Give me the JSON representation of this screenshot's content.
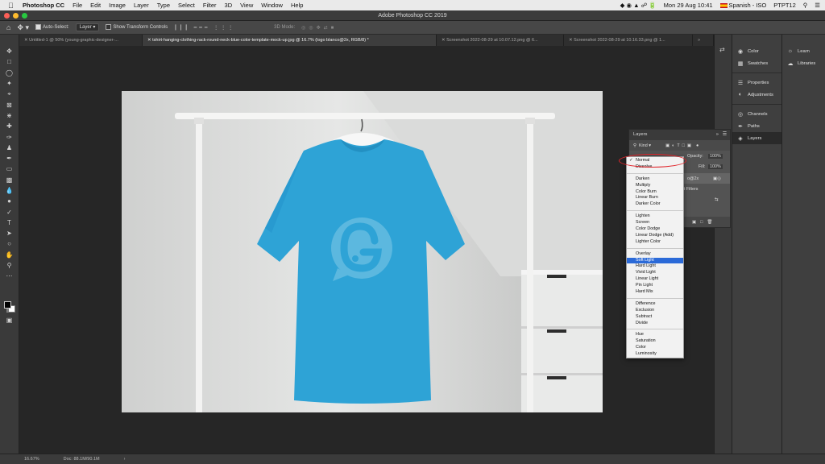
{
  "menubar": {
    "app_name": "Photoshop CC",
    "menus": [
      "File",
      "Edit",
      "Image",
      "Layer",
      "Type",
      "Select",
      "Filter",
      "3D",
      "View",
      "Window",
      "Help"
    ],
    "datetime": "Mon 29 Aug  10:41",
    "input_source": "Spanish - ISO",
    "user": "PTPT12"
  },
  "titlebar": {
    "title": "Adobe Photoshop CC 2019"
  },
  "options": {
    "auto_select_label": "Auto-Select:",
    "auto_select_value": "Layer",
    "transform_label": "Show Transform Controls",
    "mode_3d": "3D Mode:"
  },
  "tabs": [
    "Untitled-1 @ 50% (young-graphic-designer-...",
    "tshirt-hanging-clothing-rack-round-neck-blue-color-template-mock-up.jpg @ 16.7% (logo blanco@2x, RGB/8) *",
    "Screenshot 2022-08-29 at 10.07.12.png @ 6...",
    "Screenshot 2022-08-29 at 10.16.33.png @ 1..."
  ],
  "status": {
    "zoom": "16.67%",
    "doc": "Doc: 88.1M/90.1M"
  },
  "dock1": [
    {
      "icon": "color-icon",
      "label": "Color"
    },
    {
      "icon": "swatches-icon",
      "label": "Swatches"
    },
    {
      "icon": "properties-icon",
      "label": "Properties"
    },
    {
      "icon": "adjustments-icon",
      "label": "Adjustments"
    },
    {
      "icon": "channels-icon",
      "label": "Channels"
    },
    {
      "icon": "paths-icon",
      "label": "Paths"
    },
    {
      "icon": "layers-icon",
      "label": "Layers"
    }
  ],
  "dock2": [
    {
      "icon": "learn-icon",
      "label": "Learn"
    },
    {
      "icon": "libraries-icon",
      "label": "Libraries"
    }
  ],
  "layers_panel": {
    "title": "Layers",
    "kind_label": "Kind",
    "opacity_label": "Opacity:",
    "opacity_value": "100%",
    "fill_label": "Fill:",
    "fill_value": "100%",
    "layer_name_fragment": "o@2x",
    "filters_fragment": "rt Filters"
  },
  "blend_modes": {
    "groups": [
      [
        "Normal",
        "Dissolve"
      ],
      [
        "Darken",
        "Multiply",
        "Color Burn",
        "Linear Burn",
        "Darker Color"
      ],
      [
        "Lighten",
        "Screen",
        "Color Dodge",
        "Linear Dodge (Add)",
        "Lighter Color"
      ],
      [
        "Overlay",
        "Soft Light",
        "Hard Light",
        "Vivid Light",
        "Linear Light",
        "Pin Light",
        "Hard Mix"
      ],
      [
        "Difference",
        "Exclusion",
        "Subtract",
        "Divide"
      ],
      [
        "Hue",
        "Saturation",
        "Color",
        "Luminosity"
      ]
    ],
    "checked": "Normal",
    "highlighted": "Soft Light"
  },
  "colors": {
    "tshirt": "#2ea3d6",
    "logo": "#5cb8df",
    "highlight": "#2b6ad8",
    "annotation": "#e0242a"
  }
}
